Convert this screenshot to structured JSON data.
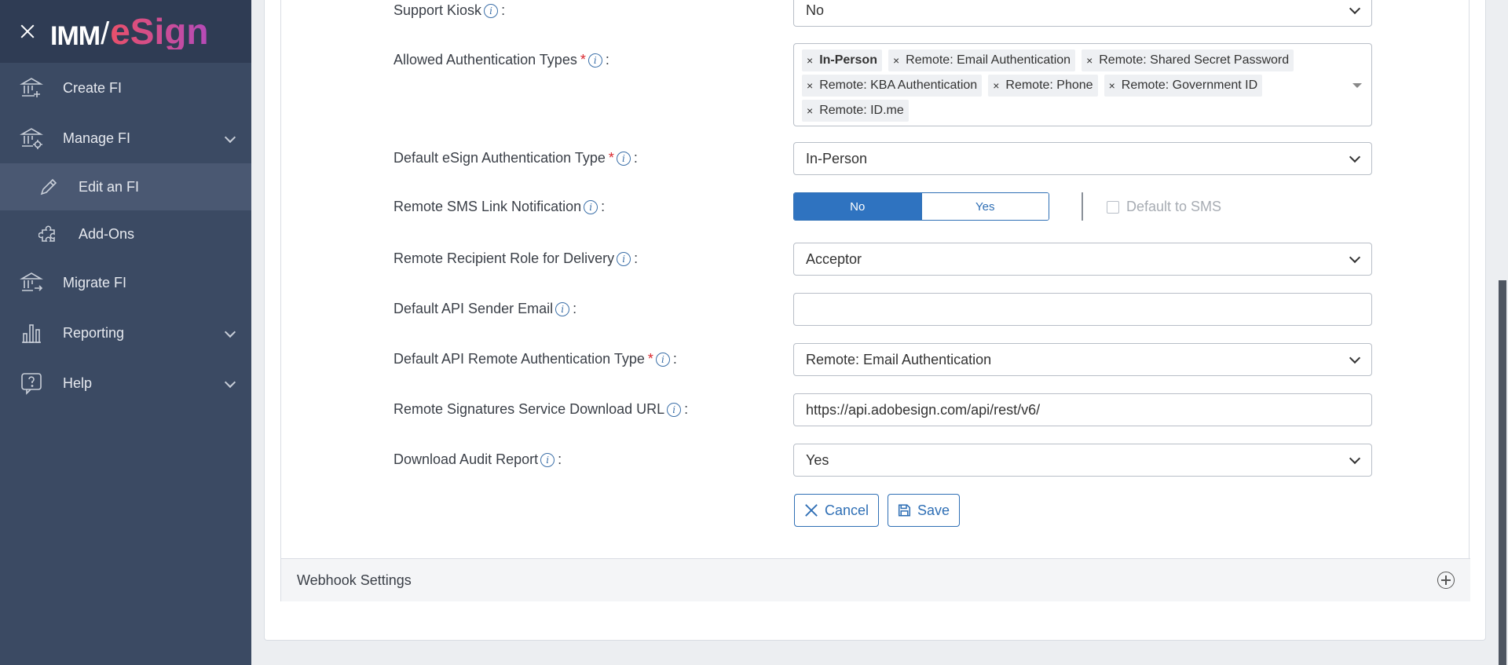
{
  "brand": {
    "imm": "IMM",
    "esign": "eSign"
  },
  "sidebar": {
    "items": [
      {
        "label": "Create FI",
        "icon": "bank-plus-icon"
      },
      {
        "label": "Manage FI",
        "icon": "bank-gear-icon",
        "expandable": true
      },
      {
        "label": "Edit an FI",
        "icon": "pencil-icon",
        "sub": true,
        "active": true
      },
      {
        "label": "Add-Ons",
        "icon": "puzzle-icon",
        "sub": true
      },
      {
        "label": "Migrate FI",
        "icon": "bank-arrow-icon"
      },
      {
        "label": "Reporting",
        "icon": "bar-chart-icon",
        "expandable": true
      },
      {
        "label": "Help",
        "icon": "help-bubble-icon",
        "expandable": true
      }
    ]
  },
  "form": {
    "support_kiosk": {
      "label": "Support Kiosk",
      "value": "No"
    },
    "allowed_auth": {
      "label": "Allowed Authentication Types",
      "tags": [
        "In-Person",
        "Remote: Email Authentication",
        "Remote: Shared Secret Password",
        "Remote: KBA Authentication",
        "Remote: Phone",
        "Remote: Government ID",
        "Remote: ID.me"
      ]
    },
    "default_esign_auth": {
      "label": "Default eSign Authentication Type",
      "value": "In-Person"
    },
    "remote_sms": {
      "label": "Remote SMS Link Notification",
      "no": "No",
      "yes": "Yes",
      "selected": "No",
      "default_to_sms": "Default to SMS"
    },
    "remote_recipient_role": {
      "label": "Remote Recipient Role for Delivery",
      "value": "Acceptor"
    },
    "default_api_sender_email": {
      "label": "Default API Sender Email",
      "value": ""
    },
    "default_api_remote_auth": {
      "label": "Default API Remote Authentication Type",
      "value": "Remote: Email Authentication"
    },
    "remote_sig_url": {
      "label": "Remote Signatures Service Download URL",
      "value": "https://api.adobesign.com/api/rest/v6/"
    },
    "download_audit": {
      "label": "Download Audit Report",
      "value": "Yes"
    },
    "colon": ":",
    "required_mark": "*",
    "info_glyph": "i",
    "cancel": "Cancel",
    "save": "Save"
  },
  "webhook": {
    "title": "Webhook Settings"
  },
  "colors": {
    "sidebar": "#3b4a63",
    "brand_bg": "#2f3c54",
    "accent": "#2f73c0",
    "required": "#d9272e"
  }
}
